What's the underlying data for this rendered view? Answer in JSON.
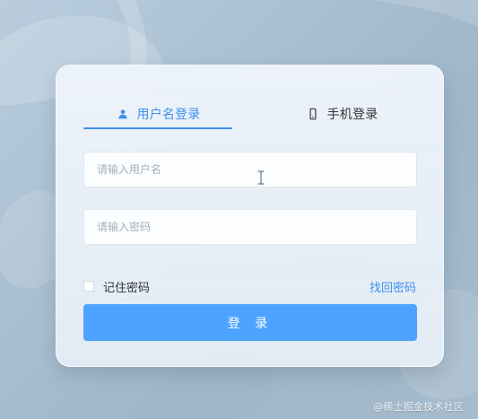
{
  "tabs": {
    "username_login": {
      "label": "用户名登录",
      "icon": "user-icon",
      "active": true
    },
    "phone_login": {
      "label": "手机登录",
      "icon": "phone-icon",
      "active": false
    }
  },
  "form": {
    "username": {
      "placeholder": "请输入用户名",
      "value": ""
    },
    "password": {
      "placeholder": "请输入密码",
      "value": ""
    },
    "remember_me": {
      "label": "记住密码",
      "checked": false
    },
    "forgot_password": {
      "label": "找回密码"
    },
    "submit": {
      "label": "登 录"
    }
  },
  "watermark": {
    "text": "@稀土掘金技术社区"
  },
  "colors": {
    "accent": "#3f8ff0",
    "button": "#4da3ff",
    "text_dark": "#333333",
    "placeholder": "#a7b0ba"
  }
}
